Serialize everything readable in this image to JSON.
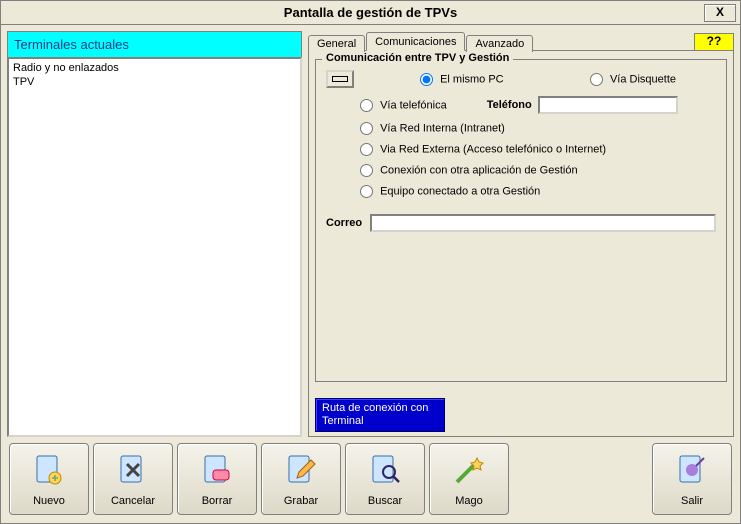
{
  "window": {
    "title": "Pantalla de gestión de TPVs",
    "close": "X"
  },
  "left": {
    "header": "Terminales actuales",
    "items": [
      "Radio y no enlazados",
      "TPV"
    ]
  },
  "tabs": {
    "general": "General",
    "comunicaciones": "Comunicaciones",
    "avanzado": "Avanzado",
    "help": "??",
    "active": "comunicaciones"
  },
  "group": {
    "title": "Comunicación entre TPV y Gestión",
    "opts": {
      "same_pc": "El mismo PC",
      "disquette": "Vía Disquette",
      "telefonica": "Vía telefónica",
      "telefono_label": "Teléfono",
      "telefono_value": "",
      "intranet": "Vía Red Interna (Intranet)",
      "externa": "Via Red Externa (Acceso telefónico o Internet)",
      "otra_app": "Conexión con otra aplicación de Gestión",
      "otra_gestion": "Equipo conectado a otra Gestión",
      "selected": "same_pc"
    },
    "correo_label": "Correo",
    "correo_value": ""
  },
  "route_button": "Ruta de conexión con Terminal",
  "toolbar": {
    "nuevo": "Nuevo",
    "cancelar": "Cancelar",
    "borrar": "Borrar",
    "grabar": "Grabar",
    "buscar": "Buscar",
    "mago": "Mago",
    "salir": "Salir"
  }
}
